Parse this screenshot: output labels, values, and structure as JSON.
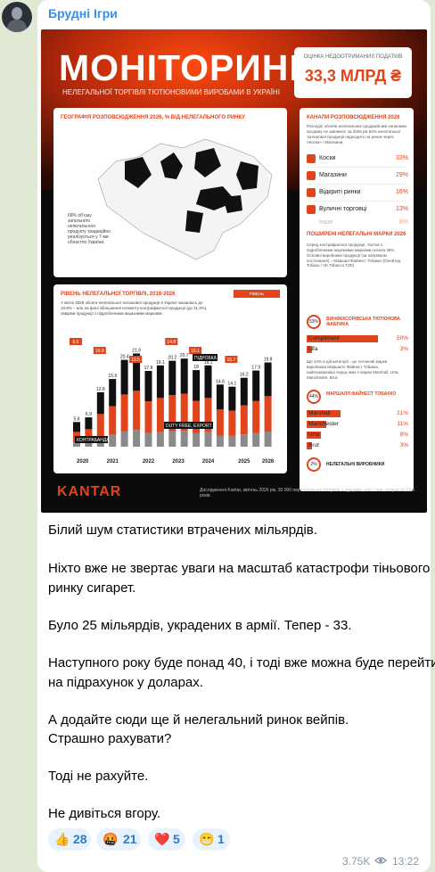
{
  "channel": {
    "name": "Брудні Ігри"
  },
  "infographic": {
    "title": "МОНІТОРИНГ",
    "subtitle": "НЕЛЕГАЛЬНОЇ ТОРГІВЛІ ТЮТЮНОВИМИ ВИРОБАМИ В УКРАЇНІ",
    "cost_label": "ОЦІНКА НЕДООТРИМАНИХ ПОДАТКІВ",
    "cost_value": "33,3 МЛРД ₴",
    "geo_title": "ГЕОГРАФІЯ РОЗПОВСЮДЖЕННЯ 2026, % ВІД НЕЛЕГАЛЬНОГО РИНКУ",
    "geo_note": "68% обʼєму загального нелегального продукту традиційно реалізується у 7-ми областях України.",
    "channels_title": "КАНАЛИ РОЗПОВСЮДЖЕННЯ 2026",
    "channels_note": "Розподіл обсягів нелегальних продажів між каналами продажу не змінився: за 2026 рік 62% нелегальної тютюнової продукції надходить на ринок через «Коски» і Магазини.",
    "channels": [
      {
        "label": "Коски",
        "pct": "33%"
      },
      {
        "label": "Магазини",
        "pct": "29%"
      },
      {
        "label": "Відкриті ринки",
        "pct": "16%"
      },
      {
        "label": "Вуличні торговці",
        "pct": "13%"
      },
      {
        "label": "Інше",
        "pct": "8%"
      }
    ],
    "brands_title": "ПОШИРЕНІ НЕЛЕГАЛЬНІ МАРКИ 2026",
    "brands_note": "Серед контрафактної продукції, частка з підробленими акцизними марками склала 38%. Основні виробники продукції (за напрямом постачання) – Маршал Файнест Тобакко (Онейтед Тобако / VK Tobacco FZE).",
    "factory1": {
      "icon": "53%",
      "name": "ВИНФЕКСОРІВСЬКА ТЮТЮНОВА ФАБРИКА"
    },
    "factory1_brands": [
      {
        "name": "Compliment",
        "pct": "50%"
      },
      {
        "name": "Lifa",
        "pct": "3%"
      }
    ],
    "factory2_note": "Ще 44% в цій категорії - це тютюнові марки виробника Маршалл Файнест Тобакко, найпоширеніші серед яких є марки Marshall, Urta, Manchester, Brut.",
    "factory2": {
      "icon": "44%",
      "name": "МАРШАЛЛ ФАЙНЕСТ ТОБАККО"
    },
    "factory2_brands": [
      {
        "name": "Marshall",
        "pct": "21%"
      },
      {
        "name": "Manchester",
        "pct": "11%"
      },
      {
        "name": "Urta",
        "pct": "8%"
      },
      {
        "name": "Brut",
        "pct": "3%"
      }
    ],
    "other_brands": {
      "pct": "2%",
      "label": "НЕЛЕГАЛЬНІ ВИРОБНИКИ"
    },
    "level_title": "РІВЕНЬ НЕЛЕГАЛЬНОЇ ТОРГІВЛІ, 2019-2026",
    "level_flag": "РІВЕНЬ НЕЛЕГАЛЬНОГО, %",
    "level_note": "У квітні 2026 обсяги нелегальної тютюнової продукції в Україні знизились до 19,8% – але на фоні збільшення сегменту контрафактної продукції (до 11,3%), завдяки продукції з підробленими акцизними марками.",
    "annotations": {
      "duty_free": "DUTY FREE, EXPORT",
      "contraband": "КОНТРАБАНДА",
      "forgery": "ПІДРОБКА"
    },
    "brand": "KANTAR",
    "footnote": "Дослідження Kantar, квітень 2026 рік, 30 000 персональних інтерв'ю з курцями, чол. і жін. старші за 18,5 років."
  },
  "chart_data": {
    "type": "bar",
    "title": "РІВЕНЬ НЕЛЕГАЛЬНОЇ ТОРГІВЛІ, 2019-2026",
    "categories": [
      "2020",
      "2021",
      "2022",
      "2023",
      "2024",
      "2025",
      "2026"
    ],
    "x": [
      5.8,
      6.9,
      12.8,
      15.9,
      20.4,
      21.9,
      17.8,
      19.1,
      20.2,
      20.7,
      18.0,
      19.1,
      14.6,
      14.1,
      16.2,
      17.9,
      19.8
    ],
    "group_of_bar": [
      0,
      0,
      1,
      1,
      1,
      2,
      2,
      2,
      3,
      3,
      4,
      4,
      4,
      5,
      5,
      5,
      6
    ],
    "values_total": [
      5.8,
      6.9,
      12.8,
      15.9,
      20.4,
      21.9,
      17.8,
      19.1,
      20.2,
      20.7,
      18.0,
      19.1,
      14.6,
      14.1,
      16.2,
      17.9,
      19.8
    ],
    "series": [
      {
        "name": "DUTY FREE, EXPORT",
        "color": "#8a8a8a"
      },
      {
        "name": "КОНТРАБАНДА",
        "color": "#e0451b"
      },
      {
        "name": "ПІДРОБКА",
        "color": "#111111"
      }
    ],
    "flags": [
      "6.6",
      "16.9",
      "19.5",
      "14.8",
      "16.1",
      "16.7"
    ]
  },
  "message": {
    "lines": [
      "Білий шум статистики втрачених мільярдів.",
      "Ніхто вже не звертає уваги на масштаб катастрофи тіньового",
      "ринку сигарет.",
      "Було 25 мільярдів, украдених в армії. Тепер - 33.",
      "Наступного року буде понад 40, і тоді вже можна буде перейти",
      "на підрахунок у доларах.",
      "А додайте сюди ще й нелегальний ринок вейпів.",
      "Страшно рахувати?",
      "Тоді не рахуйте.",
      "Не дивіться вгору."
    ]
  },
  "reactions": [
    {
      "emoji": "👍",
      "count": "28"
    },
    {
      "emoji": "🤬",
      "count": "21"
    },
    {
      "emoji": "❤️",
      "count": "5"
    },
    {
      "emoji": "😁",
      "count": "1"
    }
  ],
  "meta": {
    "views": "3.75K",
    "time": "13:22"
  }
}
